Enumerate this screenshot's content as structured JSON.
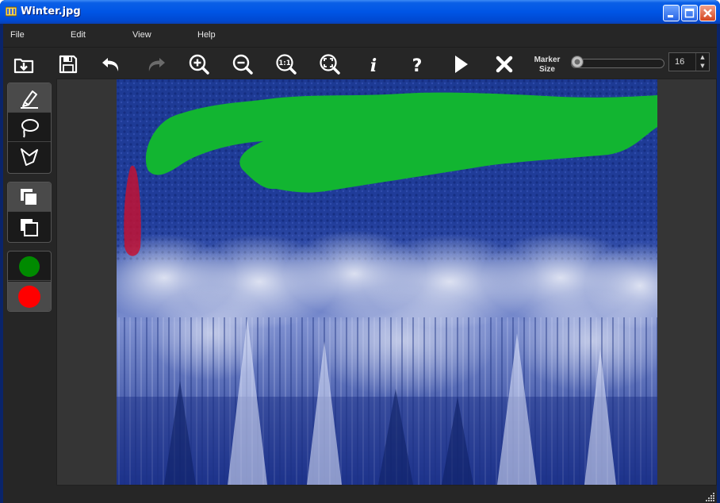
{
  "window": {
    "title": "Winter.jpg",
    "buttons": [
      "minimize",
      "maximize",
      "close"
    ]
  },
  "menu": {
    "items": [
      "File",
      "Edit",
      "View",
      "Help"
    ]
  },
  "toolbar": {
    "tools": [
      {
        "name": "open-icon"
      },
      {
        "name": "save-icon"
      },
      {
        "name": "undo-icon"
      },
      {
        "name": "redo-icon",
        "disabled": true
      },
      {
        "name": "zoom-in-icon"
      },
      {
        "name": "zoom-out-icon"
      },
      {
        "name": "actual-size-icon"
      },
      {
        "name": "fit-window-icon"
      },
      {
        "name": "info-icon"
      },
      {
        "name": "help-icon"
      },
      {
        "name": "play-icon"
      },
      {
        "name": "close-x-icon"
      }
    ],
    "marker_label_line1": "Marker",
    "marker_label_line2": "Size",
    "marker_size": "16",
    "marker_slider_fraction": 0.0
  },
  "sidebar": {
    "groups": [
      [
        "marker-icon",
        "lasso-icon",
        "polygon-lasso-icon"
      ],
      [
        "foreground-layer-icon",
        "background-layer-icon"
      ],
      [
        "green-color-swatch",
        "red-color-swatch"
      ]
    ],
    "colors": {
      "keep": "#008a00",
      "remove": "#ff0000"
    }
  },
  "canvas": {
    "image_description_icon": "winter-forest-photo",
    "green_stroke_color": "#12b531",
    "red_stroke_color": "#c8102e"
  }
}
